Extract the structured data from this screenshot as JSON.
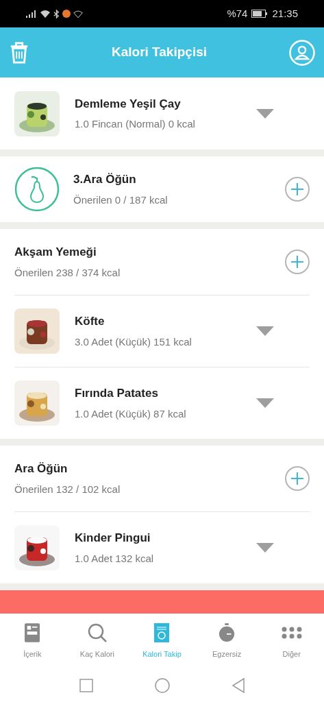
{
  "status_bar": {
    "battery": "%74",
    "time": "21:35"
  },
  "header": {
    "title": "Kalori Takipçisi"
  },
  "sections": [
    {
      "items": [
        {
          "name": "Demleme Yeşil Çay",
          "detail": "1.0 Fincan (Normal) 0 kcal"
        }
      ]
    },
    {
      "meal": {
        "title": "3.Ara Öğün",
        "recommended": "Önerilen 0 / 187 kcal",
        "kind": "icon"
      }
    },
    {
      "meal": {
        "title": "Akşam Yemeği",
        "recommended": "Önerilen 238 / 374 kcal",
        "kind": "plain"
      },
      "items": [
        {
          "name": "Köfte",
          "detail": "3.0 Adet (Küçük) 151 kcal"
        },
        {
          "name": "Fırında Patates",
          "detail": "1.0 Adet (Küçük) 87 kcal"
        }
      ]
    },
    {
      "meal": {
        "title": "Ara Öğün",
        "recommended": "Önerilen 132 / 102 kcal",
        "kind": "plain"
      },
      "items": [
        {
          "name": "Kinder Pingui",
          "detail": "1.0 Adet 132 kcal"
        }
      ]
    }
  ],
  "tabs": [
    {
      "label": "İçerik",
      "selected": false
    },
    {
      "label": "Kaç Kalori",
      "selected": false
    },
    {
      "label": "Kalori Takip",
      "selected": true
    },
    {
      "label": "Egzersiz",
      "selected": false
    },
    {
      "label": "Diğer",
      "selected": false
    }
  ]
}
